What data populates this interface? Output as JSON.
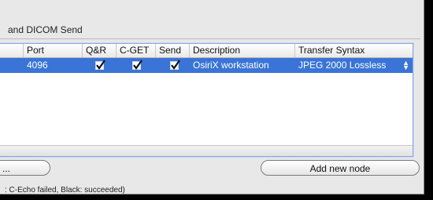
{
  "section": {
    "title": "and DICOM Send"
  },
  "table": {
    "columns": [
      "Port",
      "Q&R",
      "C-GET",
      "Send",
      "Description",
      "Transfer Syntax"
    ],
    "rows": [
      {
        "port": "4096",
        "qr": true,
        "cget": true,
        "send": true,
        "description": "OsiriX workstation",
        "transfer_syntax": "JPEG 2000 Lossless"
      }
    ]
  },
  "buttons": {
    "left_partial": "...",
    "add_node": "Add new node"
  },
  "status_text": ": C-Echo failed, Black: succeeded)",
  "icons": {
    "checkmark": "checkmark-icon",
    "stepper": "stepper-arrows-icon"
  },
  "colors": {
    "selection": "#3a74d6",
    "focus_ring": "#8aa8e0"
  }
}
